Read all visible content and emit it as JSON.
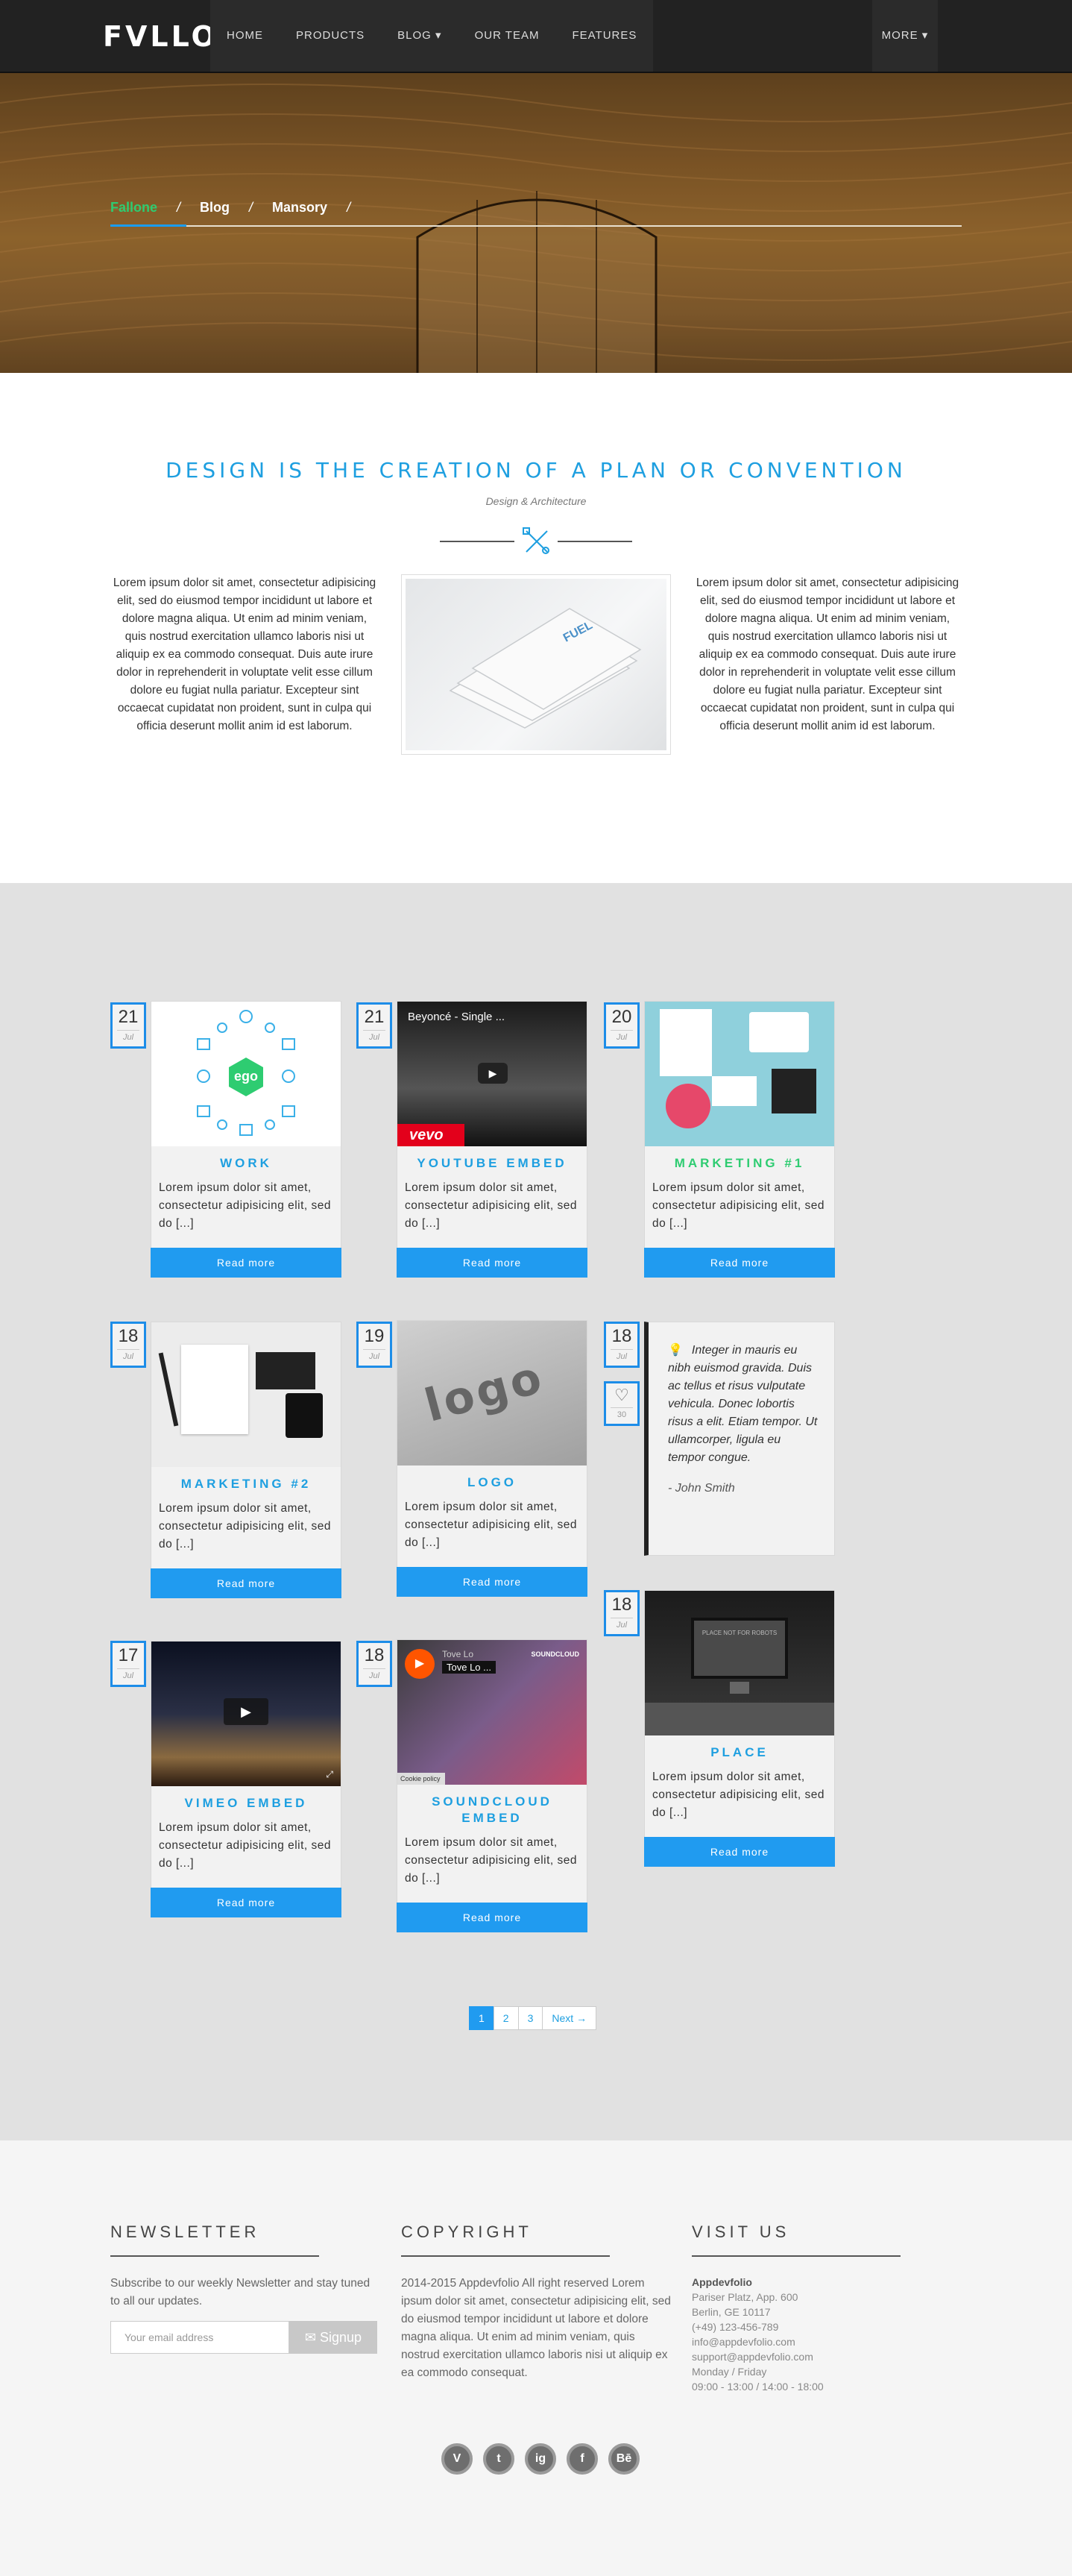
{
  "nav": {
    "logo": "FVLLONƎ",
    "items": [
      "HOME",
      "PRODUCTS",
      "BLOG ▾",
      "OUR TEAM",
      "FEATURES"
    ],
    "more": "MORE ▾"
  },
  "breadcrumb": {
    "items": [
      "Fallone",
      "Blog",
      "Mansory"
    ],
    "sep": "/"
  },
  "intro": {
    "title": "DESIGN IS THE CREATION OF A PLAN OR CONVENTION",
    "subtitle": "Design & Architecture",
    "left_text": "Lorem ipsum dolor sit amet, consectetur adipisicing elit, sed do eiusmod tempor incididunt ut labore et dolore magna aliqua. Ut enim ad minim veniam, quis nostrud exercitation ullamco laboris nisi ut aliquip ex ea commodo consequat. Duis aute irure dolor in reprehenderit in voluptate velit esse cillum dolore eu fugiat nulla pariatur. Excepteur sint occaecat cupidatat non proident, sunt in culpa qui officia deserunt mollit anim id est laborum.",
    "right_text": "Lorem ipsum dolor sit amet, consectetur adipisicing elit, sed do eiusmod tempor incididunt ut labore et dolore magna aliqua. Ut enim ad minim veniam, quis nostrud exercitation ullamco laboris nisi ut aliquip ex ea commodo consequat. Duis aute irure dolor in reprehenderit in voluptate velit esse cillum dolore eu fugiat nulla pariatur. Excepteur sint occaecat cupidatat non proident, sunt in culpa qui officia deserunt mollit anim id est laborum.",
    "image_text": "FUEL"
  },
  "cards": [
    {
      "day": "21",
      "month": "Jul",
      "title": "WORK",
      "text": "Lorem ipsum dolor sit amet, consectetur adipisicing elit, sed do [...]",
      "button": "Read more",
      "thumb_text": "ego"
    },
    {
      "day": "21",
      "month": "Jul",
      "title": "YOUTUBE EMBED",
      "text": "Lorem ipsum dolor sit amet, consectetur adipisicing elit, sed do [...]",
      "button": "Read more",
      "thumb_text": "Beyoncé - Single ...",
      "thumb_logo": "vevo"
    },
    {
      "day": "20",
      "month": "Jul",
      "title": "MARKETING #1",
      "text": "Lorem ipsum dolor sit amet, consectetur adipisicing elit, sed do [...]",
      "button": "Read more"
    },
    {
      "day": "18",
      "month": "Jul",
      "title": "MARKETING #2",
      "text": "Lorem ipsum dolor sit amet, consectetur adipisicing elit, sed do [...]",
      "button": "Read more"
    },
    {
      "day": "19",
      "month": "Jul",
      "title": "LOGO",
      "text": "Lorem ipsum dolor sit amet, consectetur adipisicing elit, sed do [...]",
      "button": "Read more",
      "thumb_text": "logo"
    },
    {
      "day": "18",
      "month": "Jul",
      "title": "PLACE",
      "text": "Lorem ipsum dolor sit amet, consectetur adipisicing elit, sed do [...]",
      "button": "Read more",
      "thumb_text": "PLACE NOT FOR ROBOTS"
    },
    {
      "day": "17",
      "month": "Jul",
      "title": "VIMEO EMBED",
      "text": "Lorem ipsum dolor sit amet, consectetur adipisicing elit, sed do [...]",
      "button": "Read more"
    },
    {
      "day": "18",
      "month": "Jul",
      "title": "SOUNDCLOUD EMBED",
      "text": "Lorem ipsum dolor sit amet, consectetur adipisicing elit, sed do [...]",
      "button": "Read more",
      "thumb_text": "Tove Lo",
      "thumb_sub": "Tove Lo ...",
      "thumb_brand": "SOUNDCLOUD",
      "thumb_cookie": "Cookie policy"
    }
  ],
  "quote": {
    "day": "18",
    "month": "Jul",
    "likes": "30",
    "text": "Integer in mauris eu nibh euismod gravida. Duis ac tellus et risus vulputate vehicula. Donec lobortis risus a elit. Etiam tempor. Ut ullamcorper, ligula eu tempor congue.",
    "author": "- John Smith"
  },
  "pagination": [
    "1",
    "2",
    "3",
    "Next →"
  ],
  "footer": {
    "newsletter_title": "NEWSLETTER",
    "newsletter_text": "Subscribe to our weekly Newsletter and stay tuned to all our updates.",
    "email_placeholder": "Your email address",
    "signup": "Signup",
    "copyright_title": "COPYRIGHT",
    "copyright_text": "2014-2015 Appdevfolio All right reserved Lorem ipsum dolor sit amet, consectetur adipisicing elit, sed do eiusmod tempor incididunt ut labore et dolore magna aliqua. Ut enim ad minim veniam, quis nostrud exercitation ullamco laboris nisi ut aliquip ex ea commodo consequat.",
    "visit_title": "VISIT US",
    "company": "Appdevfolio",
    "address": [
      "Pariser Platz, App. 600",
      "Berlin, GE 10117",
      "(+49) 123-456-789",
      "info@appdevfolio.com",
      "support@appdevfolio.com",
      "Monday / Friday",
      "09:00 - 13:00 / 14:00 - 18:00"
    ],
    "socials": [
      "V",
      "t",
      "ig",
      "f",
      "Bē"
    ]
  },
  "colors": {
    "accent": "#209bf0",
    "green": "#2ecc71",
    "nav": "#222222",
    "gray_bg": "#e1e1e1"
  }
}
